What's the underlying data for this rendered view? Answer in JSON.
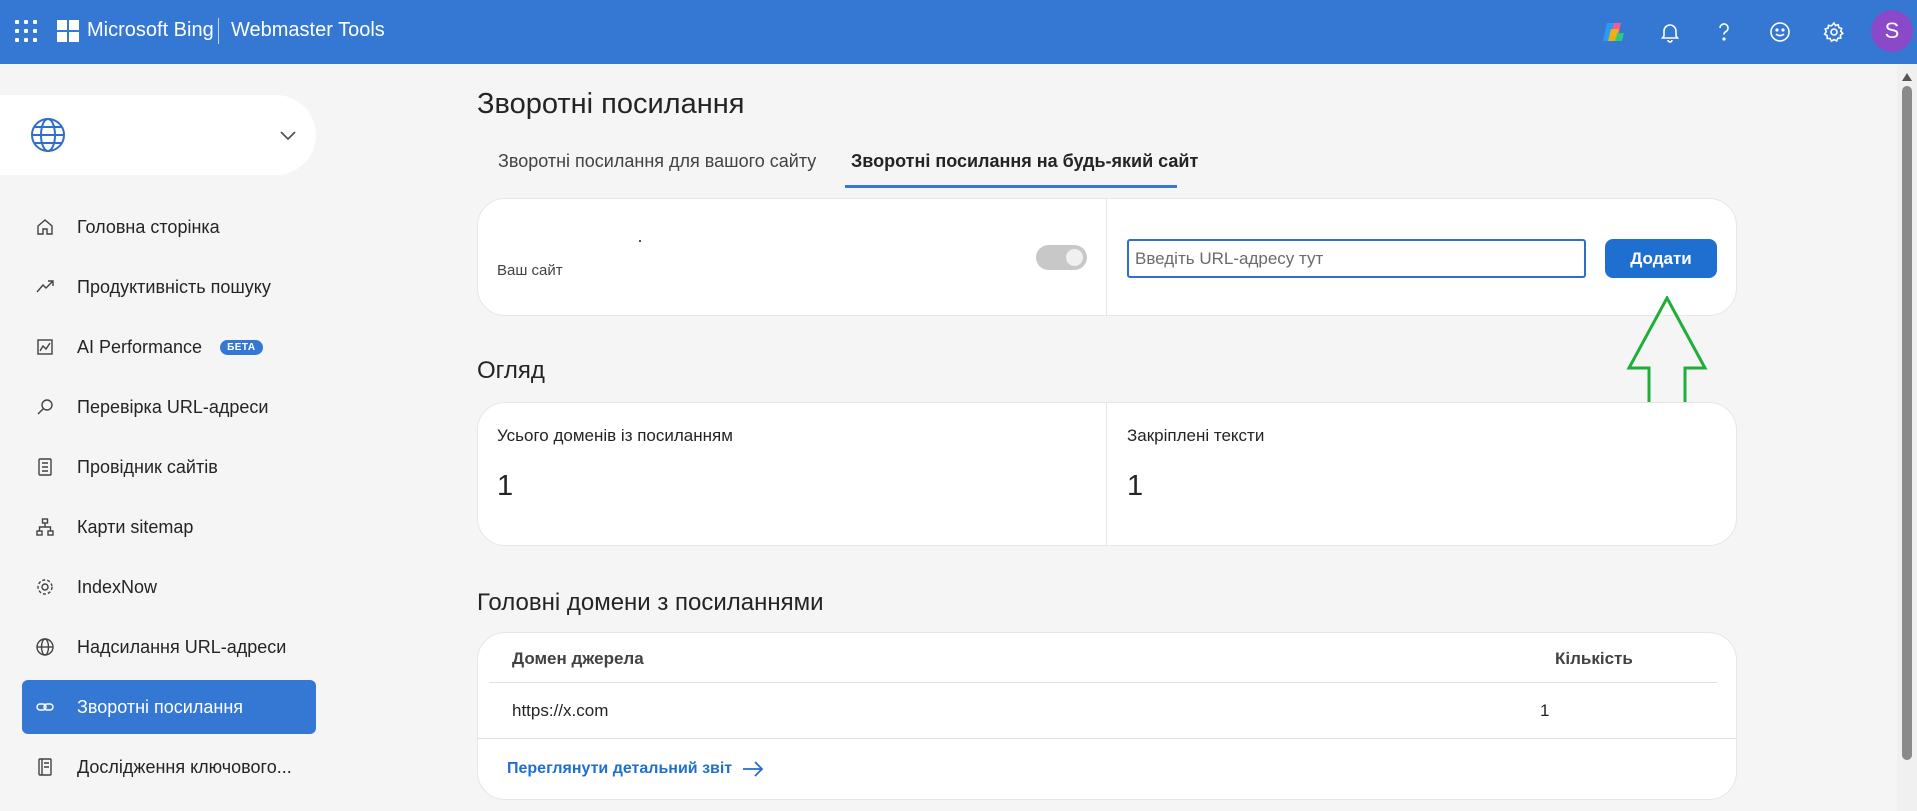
{
  "header": {
    "brand": "Microsoft Bing",
    "product": "Webmaster Tools",
    "avatar_initial": "S"
  },
  "sidebar": {
    "items": [
      {
        "label": "Головна сторінка",
        "icon": "home-icon"
      },
      {
        "label": "Продуктивність пошуку",
        "icon": "trend-icon"
      },
      {
        "label": "AI Performance",
        "icon": "chart-icon",
        "badge": "БЕТА"
      },
      {
        "label": "Перевірка URL-адреси",
        "icon": "search-icon"
      },
      {
        "label": "Провідник сайтів",
        "icon": "document-list-icon"
      },
      {
        "label": "Карти sitemap",
        "icon": "sitemap-icon"
      },
      {
        "label": "IndexNow",
        "icon": "gear-icon"
      },
      {
        "label": "Надсилання URL-адреси",
        "icon": "globe-icon"
      },
      {
        "label": "Зворотні посилання",
        "icon": "link-icon",
        "active": true
      },
      {
        "label": "Дослідження ключового...",
        "icon": "notebook-icon"
      }
    ]
  },
  "main": {
    "title": "Зворотні посилання",
    "tabs": [
      {
        "label": "Зворотні посилання для вашого сайту"
      },
      {
        "label": "Зворотні посилання на будь-який сайт",
        "active": true
      }
    ],
    "compare": {
      "site_label": "Ваш сайт",
      "url_placeholder": "Введіть URL-адресу тут",
      "add_label": "Додати"
    },
    "overview": {
      "title": "Огляд",
      "stats": [
        {
          "label": "Усього доменів із посиланням",
          "value": "1"
        },
        {
          "label": "Закріплені тексти",
          "value": "1"
        }
      ]
    },
    "domains": {
      "title": "Головні домени з посиланнями",
      "columns": [
        "Домен джерела",
        "Кількість"
      ],
      "rows": [
        {
          "domain": "https://x.com",
          "count": "1"
        }
      ],
      "report_link": "Переглянути детальний звіт"
    }
  },
  "colors": {
    "accent": "#3478d4",
    "button": "#1f6fd1",
    "annotation": "#1fae3a"
  }
}
